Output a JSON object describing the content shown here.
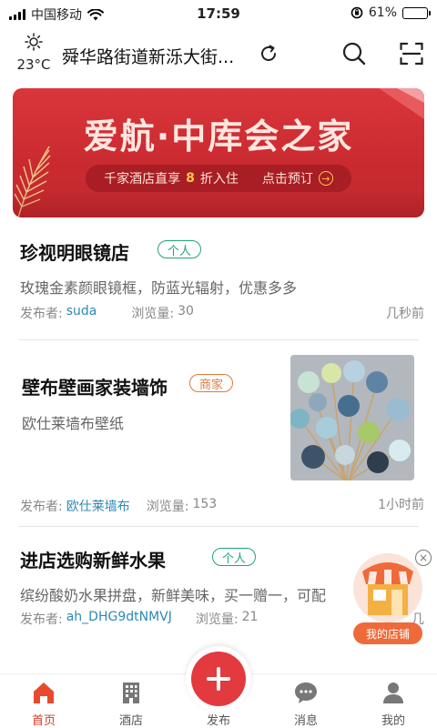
{
  "status_bar": {
    "carrier": "中国移动",
    "time": "17:59",
    "battery": "61%",
    "battery_level": 0.61
  },
  "header": {
    "temperature": "23°C",
    "location": "舜华路街道新泺大街...",
    "weather_icon": "sun-icon",
    "refresh_icon": "refresh-icon",
    "search_icon": "search-icon",
    "scan_icon": "scan-icon"
  },
  "banner": {
    "title": "爱航·中库会之家",
    "pill_prefix": "千家酒店直享",
    "pill_highlight": "8",
    "pill_suffix": "折入住",
    "pill_action": "点击预订",
    "color": "#d9363b"
  },
  "feed": [
    {
      "title": "珍视明眼镜店",
      "tag": "个人",
      "description": "玫瑰金素颜眼镜框，防蓝光辐射，优惠多多",
      "publisher_label": "发布者:",
      "publisher": "suda",
      "views_label": "浏览量:",
      "views": "30",
      "time": "几秒前"
    },
    {
      "title": "壁布壁画家装墙饰",
      "tag": "商家",
      "description": "欧仕莱墙布壁纸",
      "publisher_label": "发布者:",
      "publisher": "欧仕莱墙布",
      "views_label": "浏览量:",
      "views": "153",
      "time": "1小时前"
    },
    {
      "title": "进店选购新鲜水果",
      "tag": "个人",
      "description": "缤纷酸奶水果拼盘，新鲜美味，买一赠一，可配",
      "publisher_label": "发布者:",
      "publisher": "ah_DHG9dtNMVJ",
      "views_label": "浏览量:",
      "views": "21",
      "time": "几"
    }
  ],
  "shop_widget": {
    "label": "我的店铺",
    "close": "×"
  },
  "tabbar": {
    "items": [
      {
        "label": "首页",
        "icon": "home-icon"
      },
      {
        "label": "酒店",
        "icon": "hotel-icon"
      },
      {
        "label": "发布",
        "icon": "plus-icon"
      },
      {
        "label": "消息",
        "icon": "message-icon"
      },
      {
        "label": "我的",
        "icon": "profile-icon"
      }
    ],
    "active_color": "#d33b26",
    "publish_color": "#e23a3f"
  },
  "colors": {
    "personal_tag": "#22a37a",
    "merchant_tag": "#e07a3c",
    "publisher_link": "#2f88b5"
  }
}
